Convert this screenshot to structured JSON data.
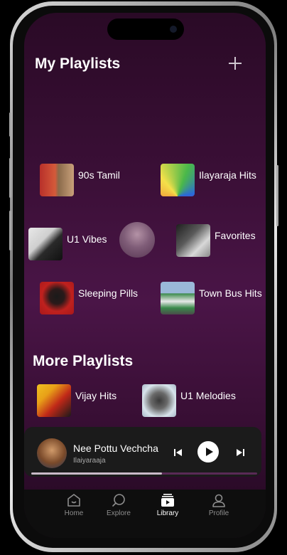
{
  "header": {
    "title": "My Playlists",
    "add_icon": "plus-icon"
  },
  "my_playlists": [
    {
      "label": "90s Tamil",
      "thumb": "couple-film-still"
    },
    {
      "label": "Ilayaraja Hits",
      "thumb": "rainbow-portrait"
    },
    {
      "label": "U1 Vibes",
      "thumb": "man-with-sunglasses"
    },
    {
      "label": "Favorites",
      "thumb": "bw-portrait"
    },
    {
      "label": "Sleeping Pills",
      "thumb": "red-background-portrait"
    },
    {
      "label": "Town Bus Hits",
      "thumb": "green-town-bus"
    }
  ],
  "more_section": {
    "title": "More Playlists",
    "items": [
      {
        "label": "Vijay Hits",
        "thumb": "vijay-poster"
      },
      {
        "label": "U1 Melodies",
        "thumb": "man-with-arms-spread"
      }
    ]
  },
  "now_playing": {
    "title": "Nee Pottu Vechcha",
    "artist": "Ilaiyaraaja",
    "progress": 0.58,
    "controls": [
      "previous-icon",
      "play-icon",
      "next-icon"
    ]
  },
  "bottom_nav": [
    {
      "label": "Home",
      "icon": "home-icon",
      "active": false
    },
    {
      "label": "Explore",
      "icon": "search-icon",
      "active": false
    },
    {
      "label": "Library",
      "icon": "library-icon",
      "active": true
    },
    {
      "label": "Profile",
      "icon": "profile-icon",
      "active": false
    }
  ],
  "colors": {
    "accent": "#4a1547",
    "background_top": "#2a0a26",
    "text": "#ffffff",
    "nav_inactive": "#8e8e8e"
  }
}
